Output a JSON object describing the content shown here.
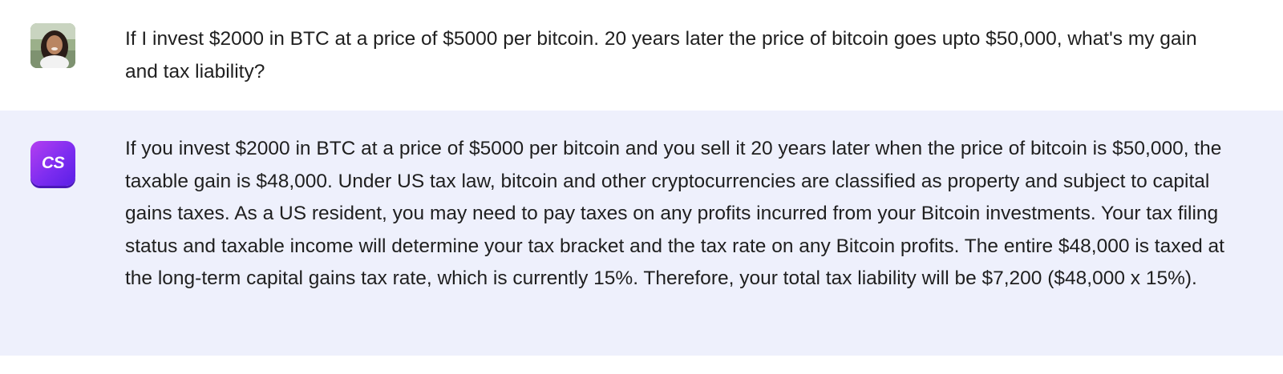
{
  "conversation": {
    "user_message": {
      "avatar_icon": "user-photo-avatar",
      "text": "If I invest $2000 in BTC at a price of $5000 per bitcoin. 20 years later the price of bitcoin goes upto $50,000, what's my gain and tax liability?"
    },
    "assistant_message": {
      "avatar_icon": "cs-logo-avatar",
      "logo_text": "CS",
      "text": "If you invest $2000 in BTC at a price of $5000 per bitcoin and you sell it 20 years later when the price of bitcoin is $50,000, the taxable gain is $48,000. Under US tax law, bitcoin and other cryptocurrencies are classified as property and subject to capital gains taxes. As a US resident, you may need to pay taxes on any profits incurred from your Bitcoin investments. Your tax filing status and taxable income will determine your tax bracket and the tax rate on any Bitcoin profits. The entire $48,000 is taxed at the long-term capital gains tax rate, which is currently 15%. Therefore, your total tax liability will be $7,200 ($48,000 x 15%)."
    }
  },
  "colors": {
    "assistant_background": "#eef0fc",
    "user_background": "#ffffff",
    "logo_gradient_start": "#b43ff0",
    "logo_gradient_end": "#5a1fe6",
    "text": "#1f1f1f"
  }
}
